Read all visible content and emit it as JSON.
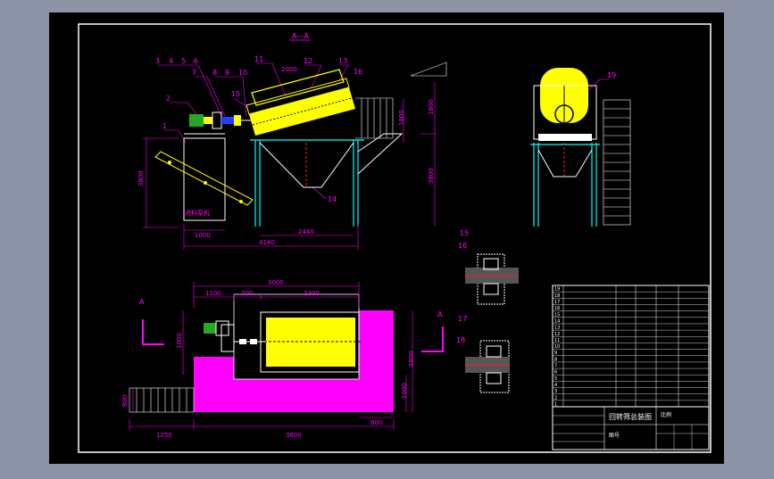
{
  "colors": {
    "background": "#8c93a6",
    "drawing": "#000000",
    "frame": "#ffffff",
    "dimension": "#ff00ff",
    "yellow": "#ffff00",
    "cyan": "#00ffff",
    "green": "#22aa22",
    "blue": "#2040ff",
    "red": "#ff2020"
  },
  "section_label": "A—A",
  "callouts": {
    "top_row": [
      "3",
      "4",
      "5",
      "6"
    ],
    "n7": "7",
    "n8": "8",
    "n9": "9",
    "n10": "10",
    "n2": "2",
    "n1": "1",
    "n11": "11",
    "n12": "12",
    "n13": "13",
    "n14": "14",
    "n15": "15",
    "n16": "16",
    "n19": "19",
    "detail_a": [
      "15",
      "16"
    ],
    "detail_b": [
      "17",
      "18"
    ]
  },
  "side_view_dims": {
    "drum_len": "2000",
    "height_total": "3800",
    "left_height": "3800",
    "right_upper": "1800",
    "right_lower": "1800",
    "base_left": "1000",
    "span_mid": "2440",
    "overall": "4140"
  },
  "box_label": "进料泵机",
  "plan_view_dims": {
    "overall_top": "3000",
    "seg1": "1100",
    "seg2": "700",
    "seg3": "2300",
    "left_h": "1000",
    "right_h": "1800",
    "right_h2": "1000",
    "left_small": "800",
    "bottom_overall": "3600",
    "bottom_left": "1250",
    "bottom_right": "800",
    "section_mark": "A"
  },
  "title_block": {
    "title": "回转筛总装图",
    "scale_label": "比例",
    "sheet_label": "图号"
  },
  "parts_list_rows": [
    "19",
    "18",
    "17",
    "16",
    "15",
    "14",
    "13",
    "12",
    "11",
    "10",
    "9",
    "8",
    "7",
    "6",
    "5",
    "4",
    "3",
    "2",
    "1"
  ]
}
